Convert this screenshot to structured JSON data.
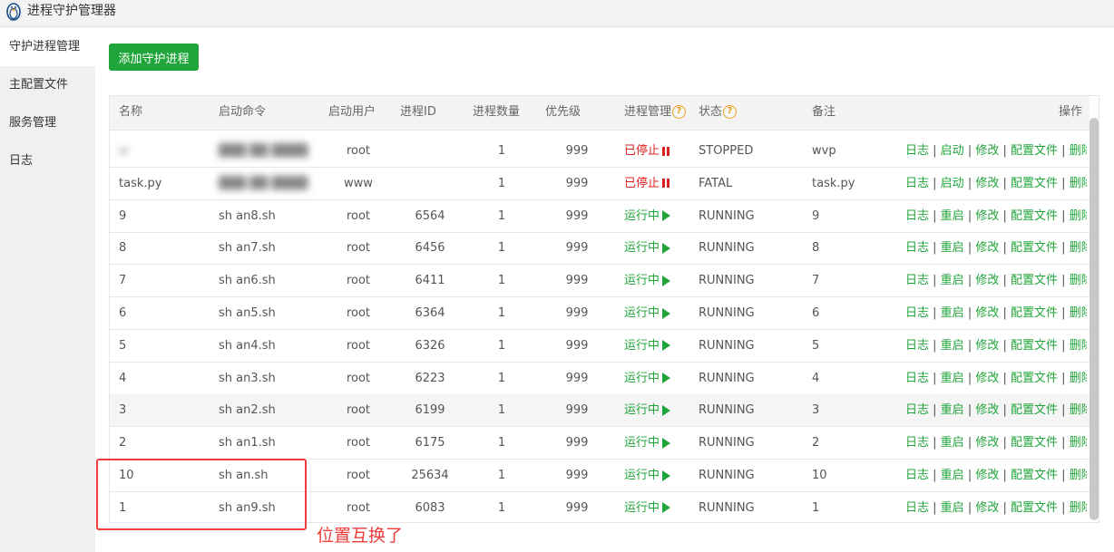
{
  "window": {
    "title": "进程守护管理器",
    "icon": "penguin-icon"
  },
  "sidebar": {
    "items": [
      {
        "label": "守护进程管理",
        "active": true
      },
      {
        "label": "主配置文件",
        "active": false
      },
      {
        "label": "服务管理",
        "active": false
      },
      {
        "label": "日志",
        "active": false
      }
    ]
  },
  "toolbar": {
    "add_label": "添加守护进程"
  },
  "colors": {
    "accent_green": "#20a53a",
    "stopped_red": "#e02020",
    "help_orange": "#f0a020",
    "annotation_red": "#f03c3c"
  },
  "table": {
    "headers": {
      "name": "名称",
      "command": "启动命令",
      "user": "启动用户",
      "pid": "进程ID",
      "count": "进程数量",
      "priority": "优先级",
      "manage": "进程管理",
      "state": "状态",
      "remark": "备注",
      "ops": "操作"
    },
    "ops_labels": {
      "log": "日志",
      "start": "启动",
      "restart": "重启",
      "edit": "修改",
      "config": "配置文件",
      "delete": "删除"
    },
    "rows": [
      {
        "name": "w",
        "command": "",
        "user": "root",
        "pid": "",
        "count": "1",
        "priority": "999",
        "manage": "已停止",
        "state": "STOPPED",
        "remark": "wvp",
        "running": false
      },
      {
        "name": "task.py",
        "command": "",
        "user": "www",
        "pid": "",
        "count": "1",
        "priority": "999",
        "manage": "已停止",
        "state": "FATAL",
        "remark": "task.py",
        "running": false
      },
      {
        "name": "9",
        "command": "sh an8.sh",
        "user": "root",
        "pid": "6564",
        "count": "1",
        "priority": "999",
        "manage": "运行中",
        "state": "RUNNING",
        "remark": "9",
        "running": true
      },
      {
        "name": "8",
        "command": "sh an7.sh",
        "user": "root",
        "pid": "6456",
        "count": "1",
        "priority": "999",
        "manage": "运行中",
        "state": "RUNNING",
        "remark": "8",
        "running": true
      },
      {
        "name": "7",
        "command": "sh an6.sh",
        "user": "root",
        "pid": "6411",
        "count": "1",
        "priority": "999",
        "manage": "运行中",
        "state": "RUNNING",
        "remark": "7",
        "running": true
      },
      {
        "name": "6",
        "command": "sh an5.sh",
        "user": "root",
        "pid": "6364",
        "count": "1",
        "priority": "999",
        "manage": "运行中",
        "state": "RUNNING",
        "remark": "6",
        "running": true
      },
      {
        "name": "5",
        "command": "sh an4.sh",
        "user": "root",
        "pid": "6326",
        "count": "1",
        "priority": "999",
        "manage": "运行中",
        "state": "RUNNING",
        "remark": "5",
        "running": true
      },
      {
        "name": "4",
        "command": "sh an3.sh",
        "user": "root",
        "pid": "6223",
        "count": "1",
        "priority": "999",
        "manage": "运行中",
        "state": "RUNNING",
        "remark": "4",
        "running": true
      },
      {
        "name": "3",
        "command": "sh an2.sh",
        "user": "root",
        "pid": "6199",
        "count": "1",
        "priority": "999",
        "manage": "运行中",
        "state": "RUNNING",
        "remark": "3",
        "running": true,
        "highlight": true
      },
      {
        "name": "2",
        "command": "sh an1.sh",
        "user": "root",
        "pid": "6175",
        "count": "1",
        "priority": "999",
        "manage": "运行中",
        "state": "RUNNING",
        "remark": "2",
        "running": true
      },
      {
        "name": "10",
        "command": "sh an.sh",
        "user": "root",
        "pid": "25634",
        "count": "1",
        "priority": "999",
        "manage": "运行中",
        "state": "RUNNING",
        "remark": "10",
        "running": true
      },
      {
        "name": "1",
        "command": "sh an9.sh",
        "user": "root",
        "pid": "6083",
        "count": "1",
        "priority": "999",
        "manage": "运行中",
        "state": "RUNNING",
        "remark": "1",
        "running": true
      }
    ]
  },
  "annotation": {
    "text": "位置互换了"
  }
}
